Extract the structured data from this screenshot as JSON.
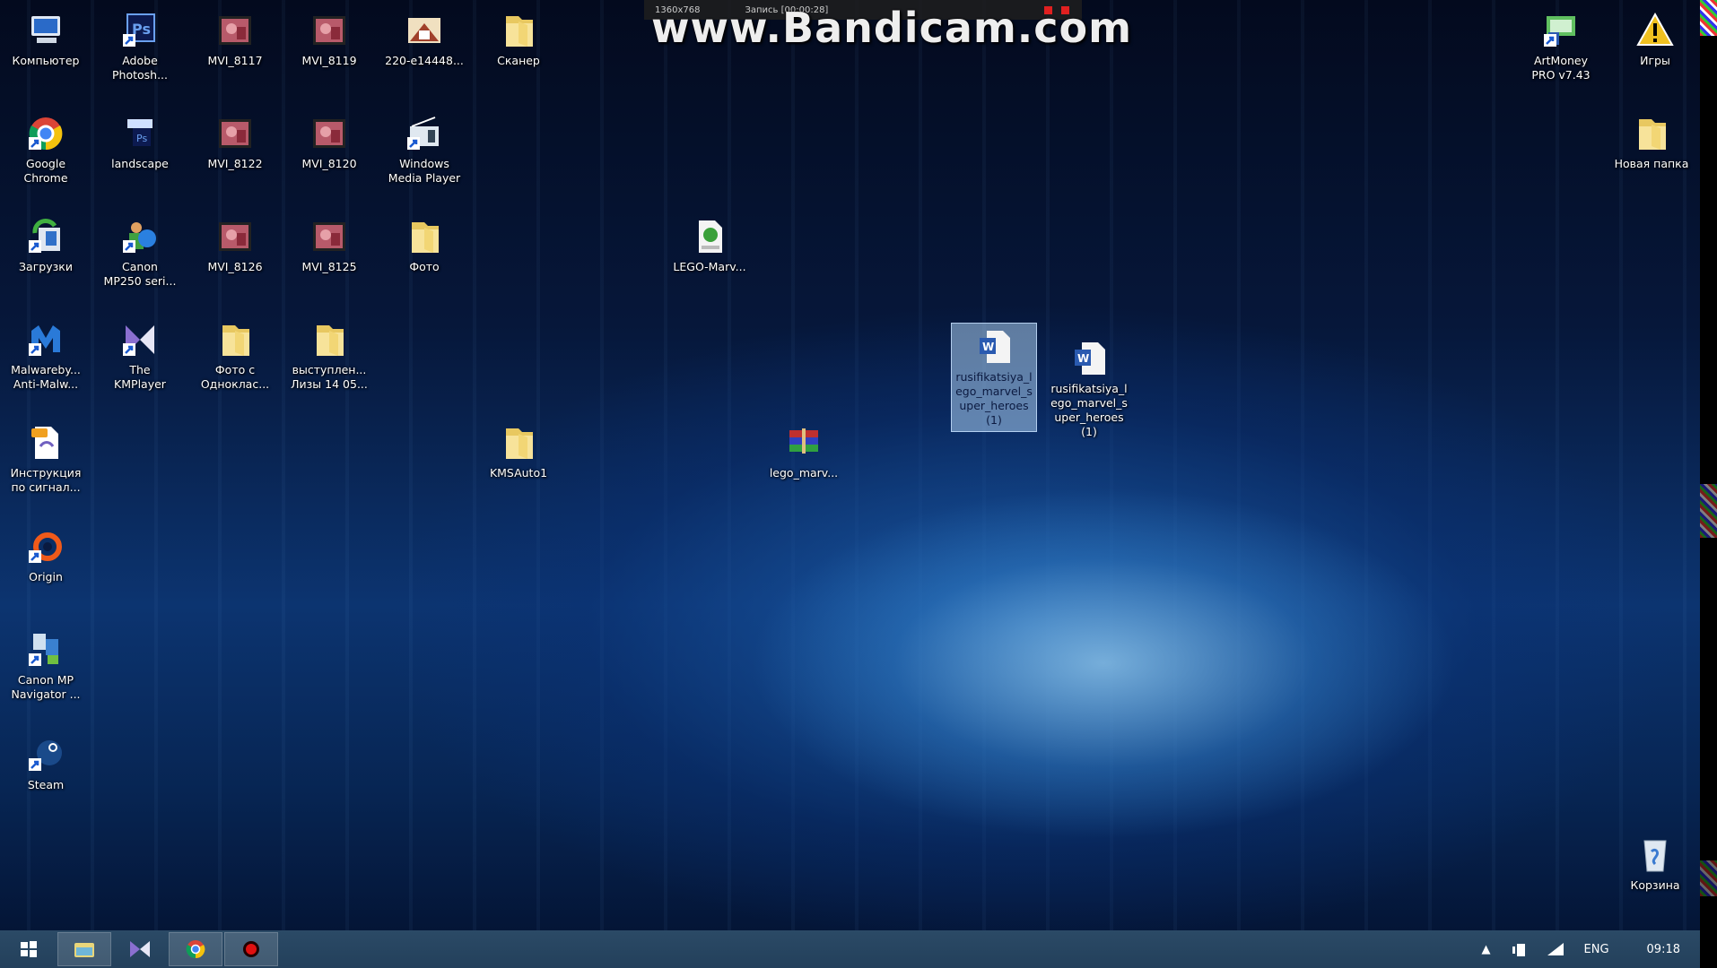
{
  "recorder": {
    "watermark": "www.Bandicam.com",
    "resolution": "1360x768",
    "status": "Запись [00:00:28]"
  },
  "desktop": {
    "icons": [
      {
        "label": "Компьютер",
        "icon": "computer-icon"
      },
      {
        "label": "Google\nChrome",
        "icon": "chrome-icon"
      },
      {
        "label": "Загрузки",
        "icon": "downloads-icon"
      },
      {
        "label": "Malwareby...\nAnti-Malw...",
        "icon": "malwarebytes-icon"
      },
      {
        "label": "Инструкция\nпо сигнал...",
        "icon": "pdf-icon"
      },
      {
        "label": "Origin",
        "icon": "origin-icon"
      },
      {
        "label": "Canon MP\nNavigator ...",
        "icon": "canon-navigator-icon"
      },
      {
        "label": "Steam",
        "icon": "steam-icon"
      },
      {
        "label": "Adobe\nPhotosh...",
        "icon": "photoshop-icon"
      },
      {
        "label": "landscape",
        "icon": "psd-file-icon"
      },
      {
        "label": "Canon\nMP250 seri...",
        "icon": "canon-printer-icon"
      },
      {
        "label": "The\nKMPlayer",
        "icon": "kmplayer-icon"
      },
      {
        "label": "MVI_8117",
        "icon": "video-icon"
      },
      {
        "label": "MVI_8122",
        "icon": "video-icon"
      },
      {
        "label": "MVI_8126",
        "icon": "video-icon"
      },
      {
        "label": "Фото с\nОдноклас...",
        "icon": "folder-icon"
      },
      {
        "label": "MVI_8119",
        "icon": "video-icon"
      },
      {
        "label": "MVI_8120",
        "icon": "video-icon"
      },
      {
        "label": "MVI_8125",
        "icon": "video-icon"
      },
      {
        "label": "выступлен...\nЛизы 14 05...",
        "icon": "folder-icon"
      },
      {
        "label": "220-e14448...",
        "icon": "image-icon"
      },
      {
        "label": "Windows\nMedia Player",
        "icon": "media-player-icon"
      },
      {
        "label": "Фото",
        "icon": "folder-icon"
      },
      {
        "label": "Сканер",
        "icon": "folder-icon"
      },
      {
        "label": "KMSAuto1",
        "icon": "folder-icon"
      },
      {
        "label": "LEGO-Marv...",
        "icon": "torrent-icon"
      },
      {
        "label": "lego_marv...",
        "icon": "rar-icon"
      },
      {
        "label": "rusifikatsiya_l\nego_marvel_s\nuper_heroes\n(1)",
        "icon": "word-doc-icon",
        "selected": true
      },
      {
        "label": "rusifikatsiya_l\nego_marvel_s\nuper_heroes\n(1)",
        "icon": "word-doc-icon"
      },
      {
        "label": "ArtMoney\nPRO v7.43",
        "icon": "artmoney-icon"
      },
      {
        "label": "Игры",
        "icon": "warning-icon"
      },
      {
        "label": "Новая папка",
        "icon": "folder-icon"
      },
      {
        "label": "Корзина",
        "icon": "recycle-bin-icon"
      }
    ]
  },
  "taskbar": {
    "start": "windows-start-icon",
    "apps": [
      {
        "icon": "file-explorer-icon",
        "active": true
      },
      {
        "icon": "kmplayer-icon",
        "active": false
      },
      {
        "icon": "chrome-icon",
        "active": true
      },
      {
        "icon": "bandicam-icon",
        "active": true
      }
    ],
    "tray": {
      "language": "ENG",
      "time": "09:18"
    }
  }
}
